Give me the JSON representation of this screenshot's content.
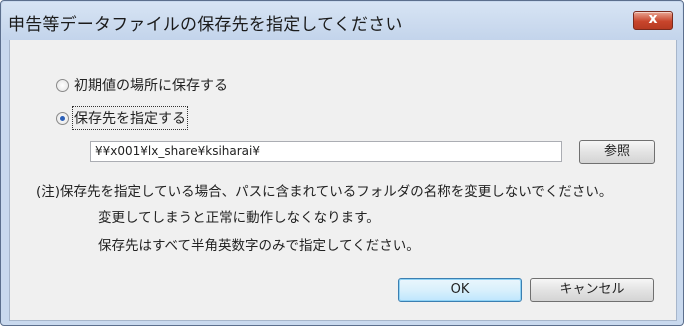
{
  "window": {
    "title": "申告等データファイルの保存先を指定してください",
    "close_glyph": "x"
  },
  "options": {
    "default_location_label": "初期値の場所に保存する",
    "specify_location_label": "保存先を指定する",
    "selected": "specify_location"
  },
  "path": {
    "value": "¥¥x001¥lx_share¥ksiharai¥"
  },
  "buttons": {
    "browse_label": "参照",
    "ok_label": "OK",
    "cancel_label": "キャンセル"
  },
  "notes": {
    "line1": "(注)保存先を指定している場合、パスに含まれているフォルダの名称を変更しないでください。",
    "line2": "変更してしまうと正常に動作しなくなります。",
    "line3": "保存先はすべて半角英数字のみで指定してください。"
  },
  "colors": {
    "title_bar": "#c3d4eb",
    "close_button": "#c8452c",
    "dialog_background": "#f0f0f0",
    "default_button_border": "#3c7fb1"
  }
}
